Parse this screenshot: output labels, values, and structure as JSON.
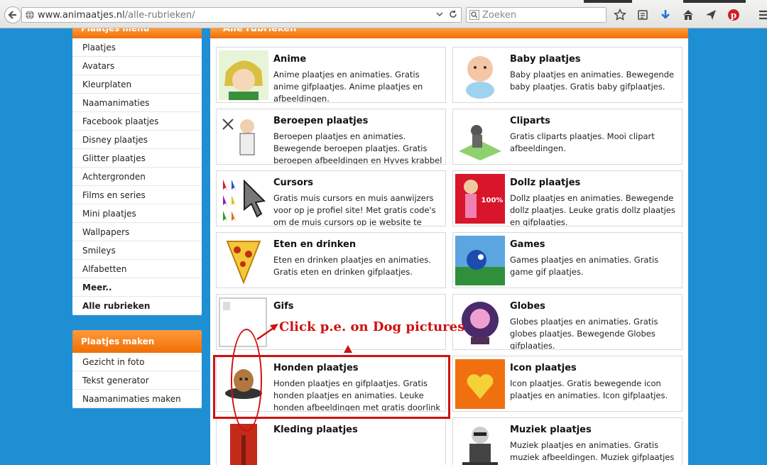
{
  "browser": {
    "url_host": "www.animaatjes.nl",
    "url_path": "/alle-rubrieken/",
    "search_placeholder": "Zoeken"
  },
  "sidebar": {
    "header": "Plaatjes menu",
    "items": [
      "Plaatjes",
      "Avatars",
      "Kleurplaten",
      "Naamanimaties",
      "Facebook plaatjes",
      "Disney plaatjes",
      "Glitter plaatjes",
      "Achtergronden",
      "Films en series",
      "Mini plaatjes",
      "Wallpapers",
      "Smileys",
      "Alfabetten",
      "Meer..",
      "Alle rubrieken"
    ]
  },
  "sidebar2": {
    "header": "Plaatjes maken",
    "items": [
      "Gezicht in foto",
      "Tekst generator",
      "Naamanimaties maken"
    ]
  },
  "main": {
    "header": "Alle rubrieken",
    "cards": [
      {
        "title": "Anime",
        "desc": "Anime plaatjes en animaties. Gratis anime gifplaatjes. Anime plaatjes en afbeeldingen."
      },
      {
        "title": "Baby plaatjes",
        "desc": "Baby plaatjes en animaties. Bewegende baby plaatjes. Gratis baby gifplaatjes."
      },
      {
        "title": "Beroepen plaatjes",
        "desc": "Beroepen plaatjes en animaties. Bewegende beroepen plaatjes. Gratis beroepen afbeeldingen en Hyves krabbel codes."
      },
      {
        "title": "Cliparts",
        "desc": "Gratis cliparts plaatjes. Mooi clipart afbeeldingen."
      },
      {
        "title": "Cursors",
        "desc": "Gratis muis cursors en muis aanwijzers voor op je profiel site! Met gratis code's om de muis cursors op je website te plaatsen of te"
      },
      {
        "title": "Dollz plaatjes",
        "desc": "Dollz plaatjes en animaties. Bewegende dollz plaatjes. Leuke gratis dollz plaatjes en gifplaatjes."
      },
      {
        "title": "Eten en drinken",
        "desc": "Eten en drinken plaatjes en animaties. Gratis eten en drinken gifplaatjes."
      },
      {
        "title": "Games",
        "desc": "Games plaatjes en animaties. Gratis game gif plaatjes."
      },
      {
        "title": "Gifs",
        "desc": ""
      },
      {
        "title": "Globes",
        "desc": "Globes plaatjes en animaties. Gratis globes plaatjes. Bewegende Globes gifplaatjes."
      },
      {
        "title": "Honden plaatjes",
        "desc": "Honden plaatjes en gifplaatjes. Gratis honden plaatjes en animaties. Leuke honden afbeeldingen met gratis doorlink codes."
      },
      {
        "title": "Icon plaatjes",
        "desc": "Icon plaatjes. Gratis bewegende icon plaatjes en animaties. Icon gifplaatjes."
      },
      {
        "title": "Kleding plaatjes",
        "desc": ""
      },
      {
        "title": "Muziek plaatjes",
        "desc": "Muziek plaatjes en animaties. Gratis muziek afbeeldingen. Muziek gifplaatjes en muziek"
      }
    ]
  },
  "annotation": {
    "text": "Click p.e. on Dog pictures"
  },
  "colors": {
    "orange": "#f07a10",
    "annotation_red": "#d01010",
    "page_blue": "#1f8fd4"
  }
}
